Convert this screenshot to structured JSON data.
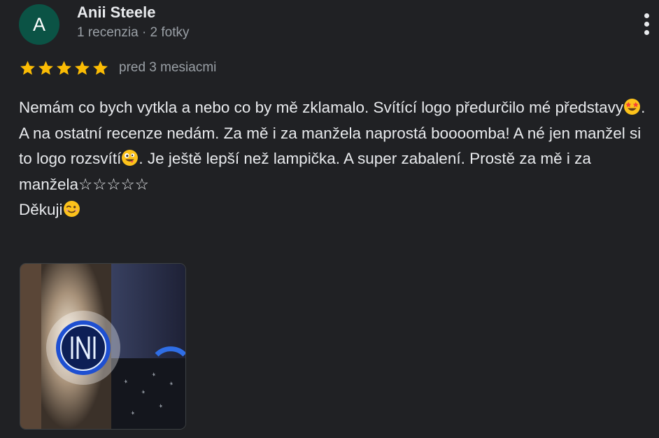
{
  "reviewer": {
    "avatar_letter": "A",
    "avatar_color": "#0b5345",
    "name": "Anii Steele",
    "meta": "1 recenzia · 2 fotky"
  },
  "review": {
    "rating": 5,
    "max_rating": 5,
    "star_color": "#fbbc04",
    "date": "pred 3 mesiacmi",
    "text_parts": {
      "p1": "Nemám co bych vytkla a nebo co by mě zklamalo. Svítící logo předurčilo mé představy",
      "p2": ". A na ostatní recenze nedám. Za mě i za manžela naprostá boooomba! A né jen manžel si to logo rozsvítí",
      "p3": ". Je ještě lepší než lampička. A super zabalení. Prostě za mě i za manžela☆☆☆☆☆",
      "p4": "Děkuji"
    },
    "emojis": [
      "star-struck-emoji",
      "zany-face-emoji",
      "winking-face-emoji"
    ]
  },
  "photos": [
    {
      "icon": "photo-thumbnail"
    }
  ],
  "actions": {
    "more_icon": "more-vertical-icon"
  }
}
